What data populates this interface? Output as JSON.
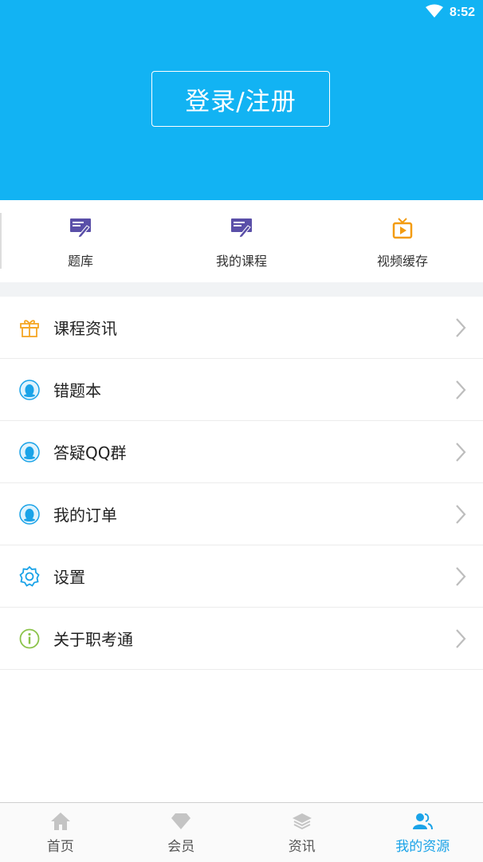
{
  "status_bar": {
    "time": "8:52",
    "wifi_icon": "wifi-icon"
  },
  "header": {
    "login_label": "登录/注册",
    "bg_color": "#12b3f3"
  },
  "quick_actions": [
    {
      "label": "题库",
      "icon": "question-bank-icon"
    },
    {
      "label": "我的课程",
      "icon": "course-icon"
    },
    {
      "label": "视频缓存",
      "icon": "tv-icon"
    }
  ],
  "menu": [
    {
      "label": "课程资讯",
      "icon": "gift-icon"
    },
    {
      "label": "错题本",
      "icon": "qq-penguin-icon"
    },
    {
      "label": "答疑QQ群",
      "icon": "qq-penguin-icon"
    },
    {
      "label": "我的订单",
      "icon": "qq-penguin-icon"
    },
    {
      "label": "设置",
      "icon": "gear-icon"
    },
    {
      "label": "关于职考通",
      "icon": "info-icon"
    }
  ],
  "bottom_nav": [
    {
      "label": "首页",
      "icon": "home-icon"
    },
    {
      "label": "会员",
      "icon": "diamond-icon"
    },
    {
      "label": "资讯",
      "icon": "layers-icon"
    },
    {
      "label": "我的资源",
      "icon": "user-icon",
      "active": true
    }
  ],
  "colors": {
    "accent": "#1aa3e8",
    "purple": "#5a4fa8",
    "orange": "#f39c12",
    "green": "#8bc34a"
  }
}
